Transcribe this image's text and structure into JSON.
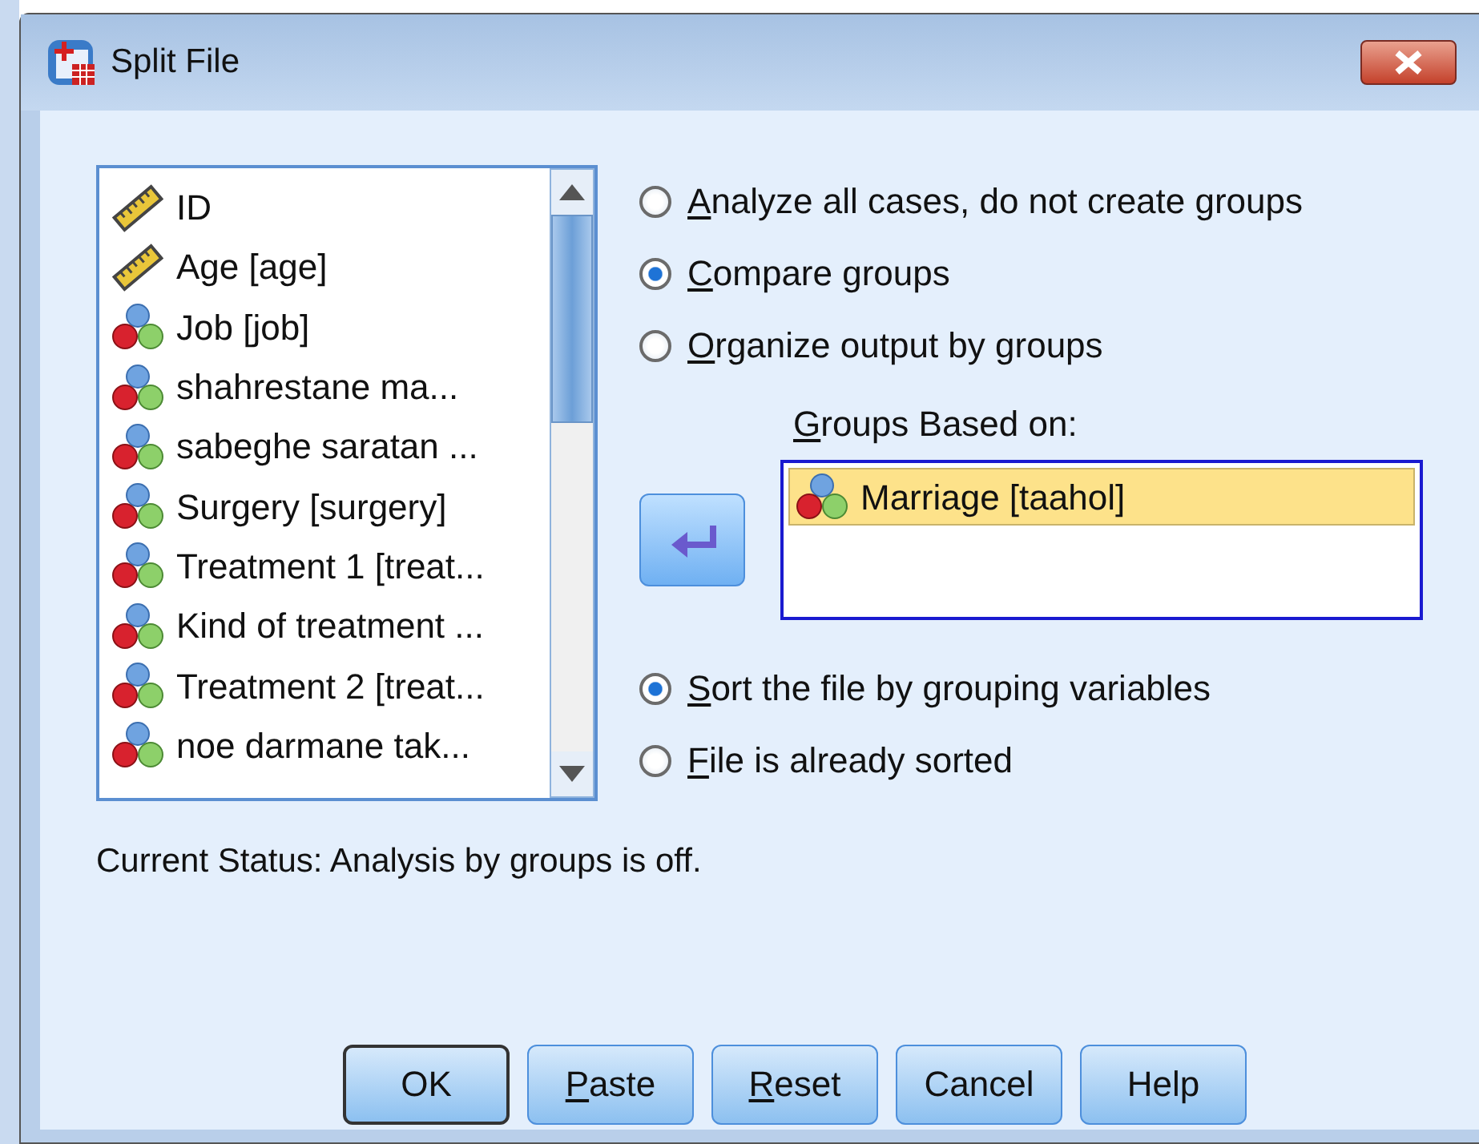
{
  "window": {
    "title": "Split File"
  },
  "variables": [
    {
      "kind": "scale",
      "label": "ID"
    },
    {
      "kind": "scale",
      "label": "Age [age]"
    },
    {
      "kind": "nominal",
      "label": "Job [job]"
    },
    {
      "kind": "nominal",
      "label": "shahrestane ma..."
    },
    {
      "kind": "nominal",
      "label": "sabeghe saratan ..."
    },
    {
      "kind": "nominal",
      "label": "Surgery [surgery]"
    },
    {
      "kind": "nominal",
      "label": "Treatment 1 [treat..."
    },
    {
      "kind": "nominal",
      "label": "Kind of treatment ..."
    },
    {
      "kind": "nominal",
      "label": "Treatment 2 [treat..."
    },
    {
      "kind": "nominal",
      "label": "noe darmane tak..."
    }
  ],
  "mode_options": [
    {
      "accel": "A",
      "rest": "nalyze all cases, do not create groups",
      "selected": false
    },
    {
      "accel": "C",
      "rest": "ompare groups",
      "selected": true
    },
    {
      "accel": "O",
      "rest": "rganize output by groups",
      "selected": false
    }
  ],
  "groups_label": {
    "accel": "G",
    "rest": "roups Based on:"
  },
  "groups": [
    {
      "kind": "nominal",
      "label": "Marriage [taahol]",
      "selected": true
    }
  ],
  "sort_options": [
    {
      "accel": "S",
      "rest": "ort the file by grouping variables",
      "selected": true
    },
    {
      "accel": "F",
      "rest": "ile is already sorted",
      "selected": false
    }
  ],
  "status": "Current Status: Analysis by groups is off.",
  "buttons": [
    {
      "rest": "OK",
      "default": true
    },
    {
      "accel": "P",
      "rest": "aste",
      "default": false
    },
    {
      "accel": "R",
      "rest": "eset",
      "default": false
    },
    {
      "rest": "Cancel",
      "default": false
    },
    {
      "rest": "Help",
      "default": false
    }
  ]
}
